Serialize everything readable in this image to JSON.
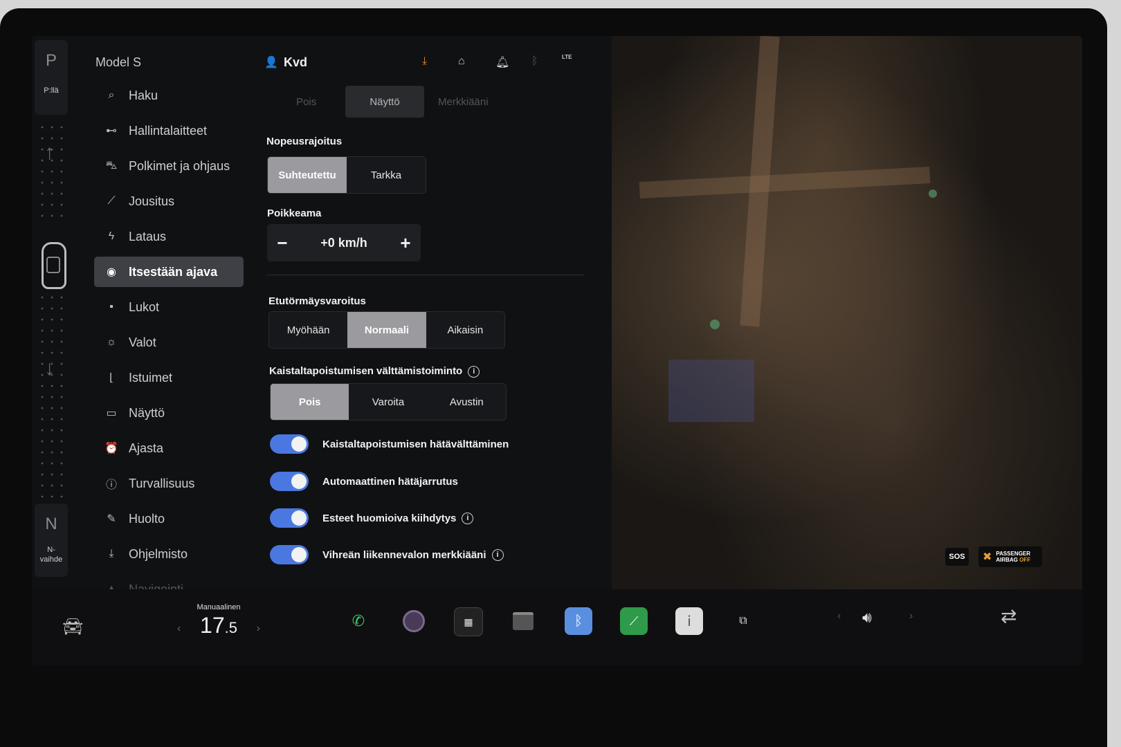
{
  "gear": {
    "top_letter": "P",
    "top_label": "P:llä",
    "bottom_letter": "N",
    "bottom_label": "N-vaihde"
  },
  "sidebar": {
    "model": "Model S",
    "items": [
      {
        "label": "Haku",
        "icon": "search-icon"
      },
      {
        "label": "Hallintalaitteet",
        "icon": "toggle-icon"
      },
      {
        "label": "Polkimet ja ohjaus",
        "icon": "car-icon"
      },
      {
        "label": "Jousitus",
        "icon": "wrench-icon"
      },
      {
        "label": "Lataus",
        "icon": "bolt-icon"
      },
      {
        "label": "Itsestään ajava",
        "icon": "steering-wheel-icon",
        "active": true
      },
      {
        "label": "Lukot",
        "icon": "lock-icon"
      },
      {
        "label": "Valot",
        "icon": "sun-icon"
      },
      {
        "label": "Istuimet",
        "icon": "seat-icon"
      },
      {
        "label": "Näyttö",
        "icon": "display-icon"
      },
      {
        "label": "Ajasta",
        "icon": "alarm-clock-icon"
      },
      {
        "label": "Turvallisuus",
        "icon": "alert-circle-icon"
      },
      {
        "label": "Huolto",
        "icon": "spanner-icon"
      },
      {
        "label": "Ohjelmisto",
        "icon": "download-icon"
      },
      {
        "label": "Navigointi",
        "icon": "navigation-icon"
      }
    ]
  },
  "topbar": {
    "user": "Kvd",
    "lte": "LTE"
  },
  "tabs": [
    "Pois",
    "Näyttö",
    "Merkkiääni"
  ],
  "speed_limit": {
    "label": "Nopeusrajoitus",
    "options": [
      "Suhteutettu",
      "Tarkka"
    ]
  },
  "offset": {
    "label": "Poikkeama",
    "minus": "−",
    "value": "+0 km/h",
    "plus": "+"
  },
  "fcw": {
    "label": "Etutörmäysvaroitus",
    "options": [
      "Myöhään",
      "Normaali",
      "Aikaisin"
    ]
  },
  "lane": {
    "label": "Kaistaltapoistumisen välttämistoiminto",
    "info": "i",
    "options": [
      "Pois",
      "Varoita",
      "Avustin"
    ]
  },
  "toggles": [
    {
      "label": "Kaistaltapoistumisen hätävälttäminen",
      "on": true,
      "info": ""
    },
    {
      "label": "Automaattinen hätäjarrutus",
      "on": true,
      "info": ""
    },
    {
      "label": "Esteet huomioiva kiihdytys",
      "on": true,
      "info": "i"
    },
    {
      "label": "Vihreän liikennevalon merkkiääni",
      "on": true,
      "info": "i"
    }
  ],
  "map": {
    "sos": "SOS",
    "airbag_line1": "PASSENGER",
    "airbag_line2": "AIRBAG",
    "airbag_off": "OFF"
  },
  "dock": {
    "climate_mode": "Manuaalinen",
    "temp_whole": "17",
    "temp_decimal": ".5",
    "apps": [
      "phone-icon",
      "camera-icon",
      "apps-launcher-icon",
      "glovebox-icon",
      "bluetooth-icon",
      "stocks-icon",
      "manual-icon",
      "toybox-icon"
    ],
    "volume_icon": "volume-icon"
  },
  "colors": {
    "accent_blue": "#4a78e0",
    "download_orange": "#e88a2e",
    "selected_segment": "#9a9a9f",
    "phone_green": "#3ecf6e"
  }
}
